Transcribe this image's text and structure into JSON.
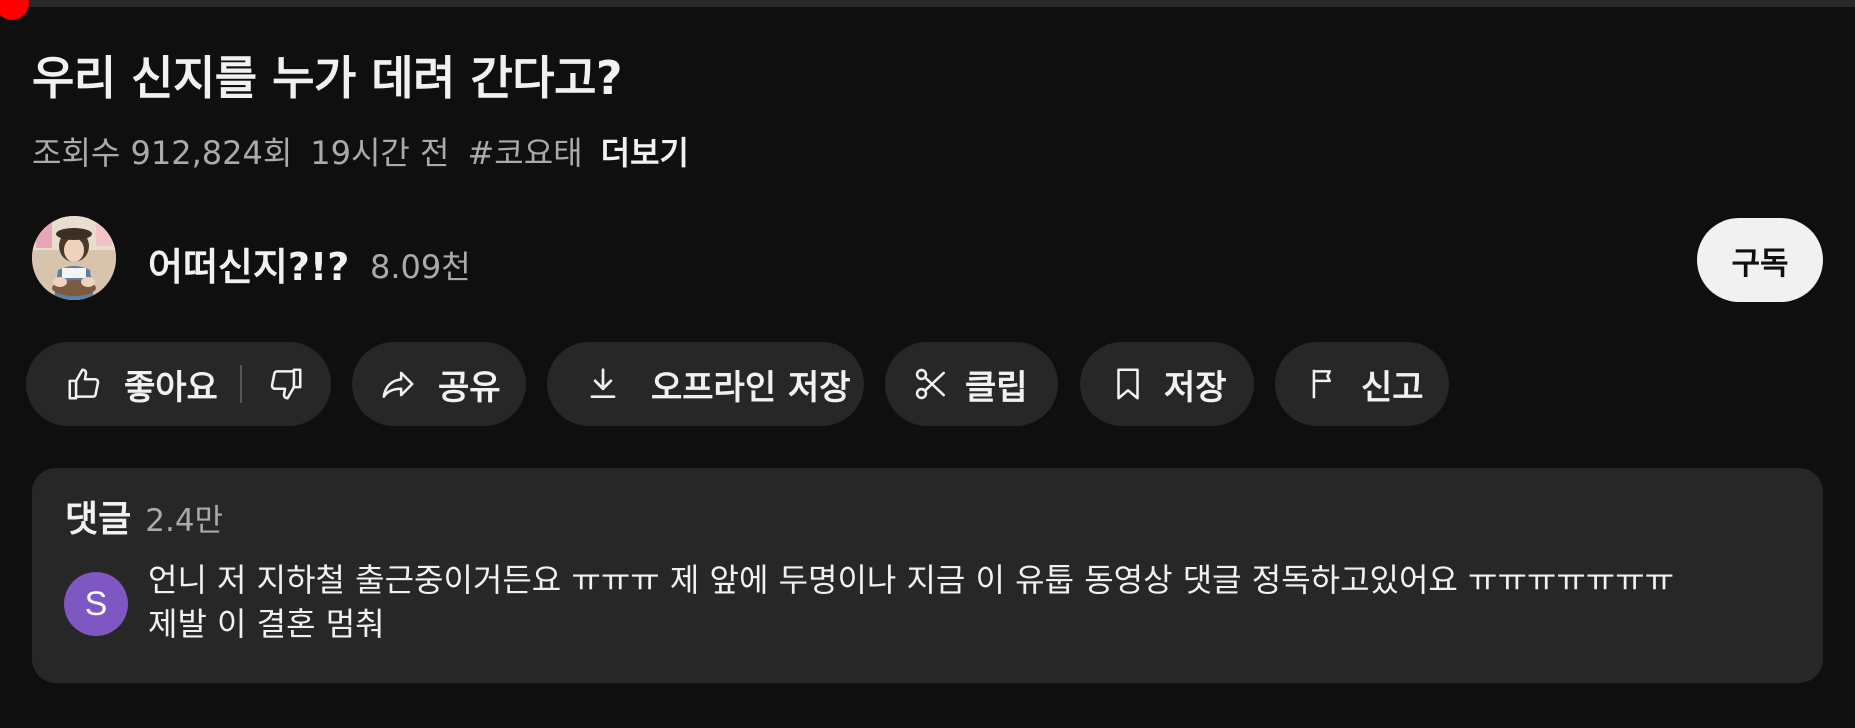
{
  "player": {
    "progress_fraction": 0.006
  },
  "video": {
    "title": "우리 신지를 누가 데려 간다고?",
    "views": "조회수 912,824회",
    "time_ago": "19시간 전",
    "hashtag": "#코요태",
    "more_label": "더보기"
  },
  "channel": {
    "name": "어떠신지?!?",
    "subscriber_count": "8.09천",
    "subscribe_label": "구독"
  },
  "actions": {
    "like_label": "좋아요",
    "share_label": "공유",
    "download_label": "오프라인 저장",
    "clip_label": "클립",
    "save_label": "저장",
    "report_label": "신고"
  },
  "comments": {
    "title": "댓글",
    "count": "2.4만",
    "top_comment": {
      "avatar_letter": "S",
      "avatar_color": "#7e57c2",
      "text": "언니 저 지하철 출근중이거든요 ㅠㅠㅠ 제 앞에 두명이나 지금 이 유툽 동영상 댓글 정독하고있어요 ㅠㅠㅠㅠㅠㅠㅠ\n제발 이 결혼 멈춰"
    }
  },
  "icons": {
    "like": "thumbs-up-icon",
    "dislike": "thumbs-down-icon",
    "share": "share-arrow-icon",
    "download": "download-icon",
    "clip": "scissors-icon",
    "save": "bookmark-icon",
    "report": "flag-icon"
  },
  "colors": {
    "background": "#0f0f0f",
    "chip": "#272727",
    "accent": "#ff0000",
    "secondary_text": "#aaaaaa"
  }
}
